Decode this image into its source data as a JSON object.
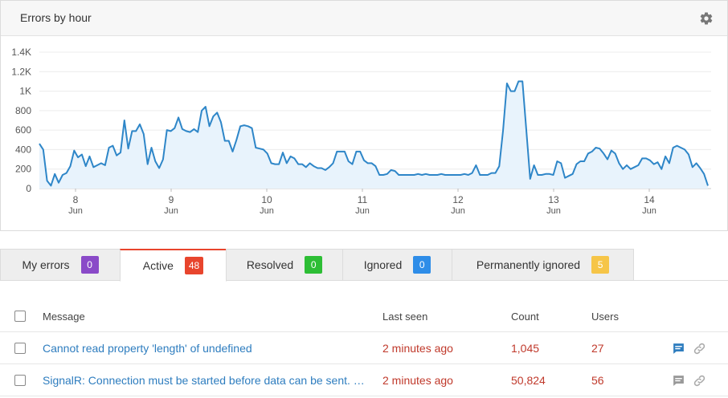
{
  "chart_panel": {
    "title": "Errors by hour",
    "settings_icon": "gear-icon"
  },
  "chart_data": {
    "type": "area",
    "title": "Errors by hour",
    "xlabel": "",
    "ylabel": "",
    "ylim": [
      0,
      1400
    ],
    "yticks": [
      {
        "value": 0,
        "label": "0"
      },
      {
        "value": 200,
        "label": "200"
      },
      {
        "value": 400,
        "label": "400"
      },
      {
        "value": 600,
        "label": "600"
      },
      {
        "value": 800,
        "label": "800"
      },
      {
        "value": 1000,
        "label": "1K"
      },
      {
        "value": 1200,
        "label": "1.2K"
      },
      {
        "value": 1400,
        "label": "1.4K"
      }
    ],
    "xticks": [
      {
        "day": "8",
        "month": "Jun"
      },
      {
        "day": "9",
        "month": "Jun"
      },
      {
        "day": "10",
        "month": "Jun"
      },
      {
        "day": "11",
        "month": "Jun"
      },
      {
        "day": "12",
        "month": "Jun"
      },
      {
        "day": "13",
        "month": "Jun"
      },
      {
        "day": "14",
        "month": "Jun"
      }
    ],
    "line_color": "#2e86c8",
    "fill_color": "#e8f3fc",
    "grid": true,
    "series": [
      {
        "values": [
          460,
          400,
          80,
          30,
          150,
          60,
          140,
          160,
          230,
          390,
          320,
          350,
          230,
          330,
          220,
          240,
          260,
          240,
          420,
          440,
          340,
          370,
          700,
          410,
          590,
          590,
          660,
          560,
          250,
          420,
          280,
          210,
          300,
          600,
          590,
          620,
          730,
          610,
          590,
          580,
          610,
          580,
          800,
          840,
          640,
          740,
          780,
          680,
          490,
          490,
          380,
          500,
          640,
          650,
          640,
          620,
          420,
          410,
          400,
          360,
          260,
          250,
          250,
          370,
          260,
          330,
          310,
          250,
          250,
          220,
          260,
          230,
          210,
          210,
          190,
          220,
          260,
          380,
          380,
          380,
          280,
          250,
          380,
          380,
          290,
          260,
          260,
          230,
          140,
          140,
          150,
          190,
          180,
          140,
          140,
          140,
          140,
          140,
          150,
          140,
          150,
          140,
          140,
          140,
          150,
          140,
          140,
          140,
          140,
          140,
          150,
          140,
          160,
          240,
          140,
          140,
          140,
          160,
          160,
          230,
          600,
          1080,
          1000,
          1000,
          1100,
          1100,
          600,
          100,
          240,
          140,
          140,
          150,
          150,
          140,
          280,
          260,
          110,
          130,
          150,
          250,
          280,
          280,
          360,
          380,
          420,
          410,
          360,
          300,
          390,
          360,
          260,
          200,
          240,
          200,
          220,
          240,
          310,
          310,
          290,
          250,
          270,
          200,
          330,
          260,
          420,
          440,
          420,
          400,
          350,
          220,
          260,
          210,
          150,
          30
        ]
      }
    ]
  },
  "tabs": [
    {
      "label": "My errors",
      "count": "0",
      "color": "#8a4ac8",
      "active": false
    },
    {
      "label": "Active",
      "count": "48",
      "color": "#e8452d",
      "active": true
    },
    {
      "label": "Resolved",
      "count": "0",
      "color": "#2dbe35",
      "active": false
    },
    {
      "label": "Ignored",
      "count": "0",
      "color": "#2e8de8",
      "active": false
    },
    {
      "label": "Permanently ignored",
      "count": "5",
      "color": "#f6c548",
      "active": false
    }
  ],
  "table": {
    "columns": {
      "message": "Message",
      "last_seen": "Last seen",
      "count": "Count",
      "users": "Users"
    },
    "rows": [
      {
        "message": "Cannot read property 'length' of undefined",
        "last_seen": "2 minutes ago",
        "count": "1,045",
        "users": "27",
        "comment_icon": "comment-icon",
        "comment_color": "#2e7dbf",
        "link_icon": "link-icon"
      },
      {
        "message": "SignalR: Connection must be started before data can be sent. Call .start() before .send()",
        "last_seen": "2 minutes ago",
        "count": "50,824",
        "users": "56",
        "comment_icon": "comment-icon",
        "comment_color": "#999999",
        "link_icon": "link-icon"
      }
    ]
  }
}
